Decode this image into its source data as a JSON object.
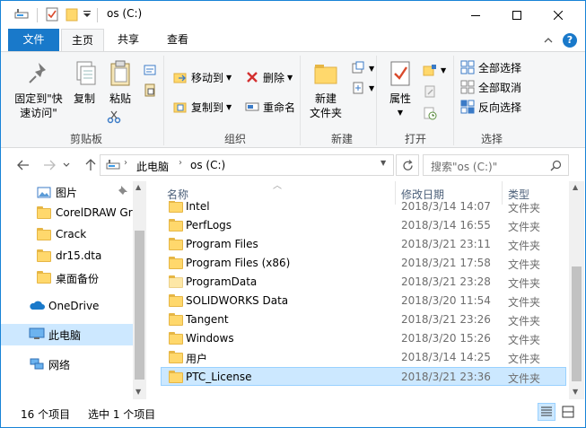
{
  "window": {
    "title": "os (C:)"
  },
  "tabs": {
    "file": "文件",
    "home": "主页",
    "share": "共享",
    "view": "查看"
  },
  "ribbon": {
    "clipboard": {
      "label": "剪贴板",
      "pin": "固定到\"快速访问\"",
      "copy": "复制",
      "paste": "粘贴"
    },
    "organize": {
      "label": "组织",
      "move_to": "移动到",
      "copy_to": "复制到",
      "delete": "删除",
      "rename": "重命名"
    },
    "new": {
      "label": "新建",
      "new_folder": "新建\n文件夹"
    },
    "open": {
      "label": "打开",
      "properties": "属性"
    },
    "select": {
      "label": "选择",
      "select_all": "全部选择",
      "select_none": "全部取消",
      "invert": "反向选择"
    }
  },
  "address": {
    "path": [
      "此电脑",
      "os (C:)"
    ],
    "search_placeholder": "搜索\"os (C:)\""
  },
  "nav": {
    "items": [
      {
        "label": "图片",
        "icon": "pictures-icon"
      },
      {
        "label": "CorelDRAW Gr",
        "icon": "folder-icon"
      },
      {
        "label": "Crack",
        "icon": "folder-icon"
      },
      {
        "label": "dr15.dta",
        "icon": "folder-icon"
      },
      {
        "label": "桌面备份",
        "icon": "folder-icon"
      },
      {
        "label": "OneDrive",
        "icon": "onedrive-icon"
      },
      {
        "label": "此电脑",
        "icon": "pc-icon"
      },
      {
        "label": "网络",
        "icon": "network-icon"
      }
    ]
  },
  "list": {
    "columns": {
      "name": "名称",
      "date": "修改日期",
      "type": "类型"
    },
    "rows": [
      {
        "name": "Intel",
        "date": "2018/3/14 14:07",
        "type": "文件夹"
      },
      {
        "name": "PerfLogs",
        "date": "2018/3/14 16:55",
        "type": "文件夹"
      },
      {
        "name": "Program Files",
        "date": "2018/3/21 23:11",
        "type": "文件夹"
      },
      {
        "name": "Program Files (x86)",
        "date": "2018/3/21 17:58",
        "type": "文件夹"
      },
      {
        "name": "ProgramData",
        "date": "2018/3/21 23:28",
        "type": "文件夹"
      },
      {
        "name": "SOLIDWORKS Data",
        "date": "2018/3/20 11:54",
        "type": "文件夹"
      },
      {
        "name": "Tangent",
        "date": "2018/3/21 23:26",
        "type": "文件夹"
      },
      {
        "name": "Windows",
        "date": "2018/3/20 15:26",
        "type": "文件夹"
      },
      {
        "name": "用户",
        "date": "2018/3/14 14:25",
        "type": "文件夹"
      },
      {
        "name": "PTC_License",
        "date": "2018/3/21 23:36",
        "type": "文件夹"
      }
    ]
  },
  "status": {
    "count": "16 个项目",
    "selected": "选中 1 个项目"
  },
  "colors": {
    "accent": "#1979ca",
    "selection": "#cce8ff",
    "selection_border": "#99d1ff",
    "folder": "#ffd86c"
  }
}
